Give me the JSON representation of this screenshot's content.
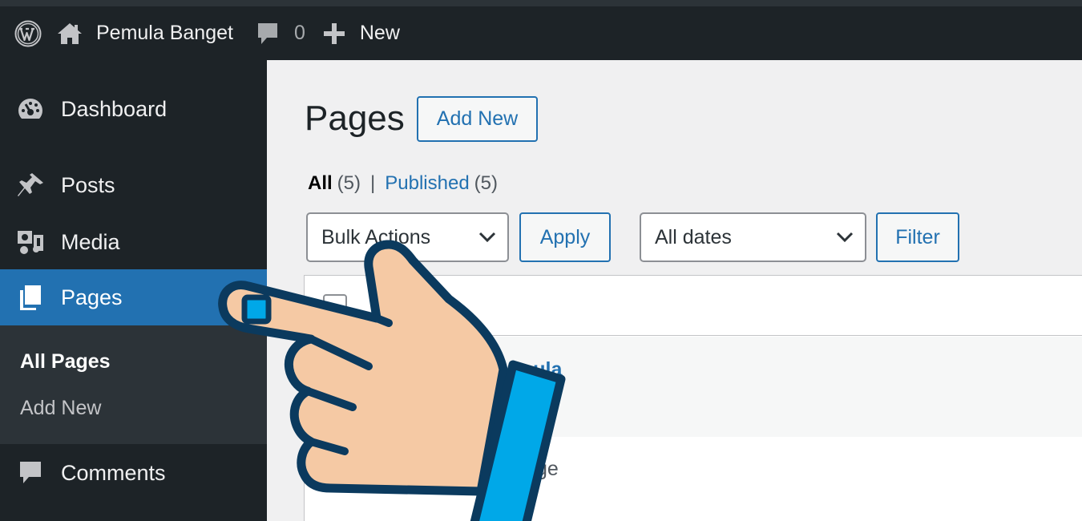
{
  "adminbar": {
    "site_name": "Pemula Banget",
    "comment_count": "0",
    "new_label": "New"
  },
  "sidebar": {
    "items": [
      {
        "label": "Dashboard",
        "icon": "dashboard-icon"
      },
      {
        "label": "Posts",
        "icon": "pin-icon"
      },
      {
        "label": "Media",
        "icon": "media-icon"
      },
      {
        "label": "Pages",
        "icon": "pages-icon",
        "current": true
      },
      {
        "label": "Comments",
        "icon": "comment-icon"
      }
    ],
    "submenu": [
      {
        "label": "All Pages",
        "current": true
      },
      {
        "label": "Add New"
      }
    ]
  },
  "main": {
    "title": "Pages",
    "add_new_label": "Add New",
    "views": {
      "all_label": "All",
      "all_count": "(5)",
      "separator": "|",
      "published_label": "Published",
      "published_count": "(5)"
    },
    "bulk_actions": "Bulk Actions",
    "apply_label": "Apply",
    "dates": "All dates",
    "filter_label": "Filter",
    "rows": [
      {
        "title_partial": "mula"
      },
      {
        "title_partial": "ge"
      }
    ]
  },
  "colors": {
    "adminbar_bg": "#1d2327",
    "accent": "#2271b1",
    "hand_skin": "#f5c9a4",
    "hand_cuff": "#00a8e8",
    "hand_outline": "#0b3a5e"
  }
}
